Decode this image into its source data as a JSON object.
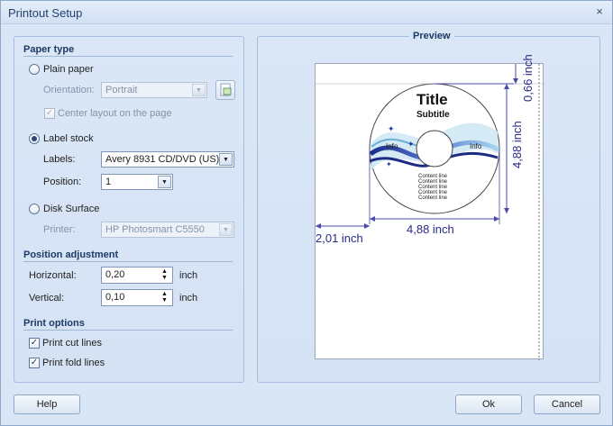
{
  "window": {
    "title": "Printout Setup",
    "close": "×"
  },
  "paper_type": {
    "heading": "Paper type",
    "plain_paper": "Plain paper",
    "orientation_label": "Orientation:",
    "orientation_value": "Portrait",
    "center_layout": "Center layout on the page",
    "label_stock": "Label stock",
    "labels_label": "Labels:",
    "labels_value": "Avery 8931 CD/DVD (US)",
    "position_label": "Position:",
    "position_value": "1",
    "disk_surface": "Disk Surface",
    "printer_label": "Printer:",
    "printer_value": "HP Photosmart C5550",
    "selected": "label_stock"
  },
  "position_adjustment": {
    "heading": "Position adjustment",
    "horizontal_label": "Horizontal:",
    "horizontal_value": "0,20",
    "vertical_label": "Vertical:",
    "vertical_value": "0,10",
    "unit": "inch"
  },
  "print_options": {
    "heading": "Print options",
    "cut_lines": "Print cut lines",
    "fold_lines": "Print fold lines",
    "cut_checked": true,
    "fold_checked": true
  },
  "preview": {
    "title": "Preview",
    "disc_title": "Title",
    "disc_subtitle": "Subtitle",
    "info_left": "Info",
    "info_right": "Info",
    "content_lines": [
      "Content line",
      "Content line",
      "Content line",
      "Content line",
      "Content line"
    ],
    "dim_top": "0,66 inch",
    "dim_height": "4,88 inch",
    "dim_width": "4,88 inch",
    "dim_left": "2,01 inch"
  },
  "buttons": {
    "help": "Help",
    "ok": "Ok",
    "cancel": "Cancel"
  }
}
